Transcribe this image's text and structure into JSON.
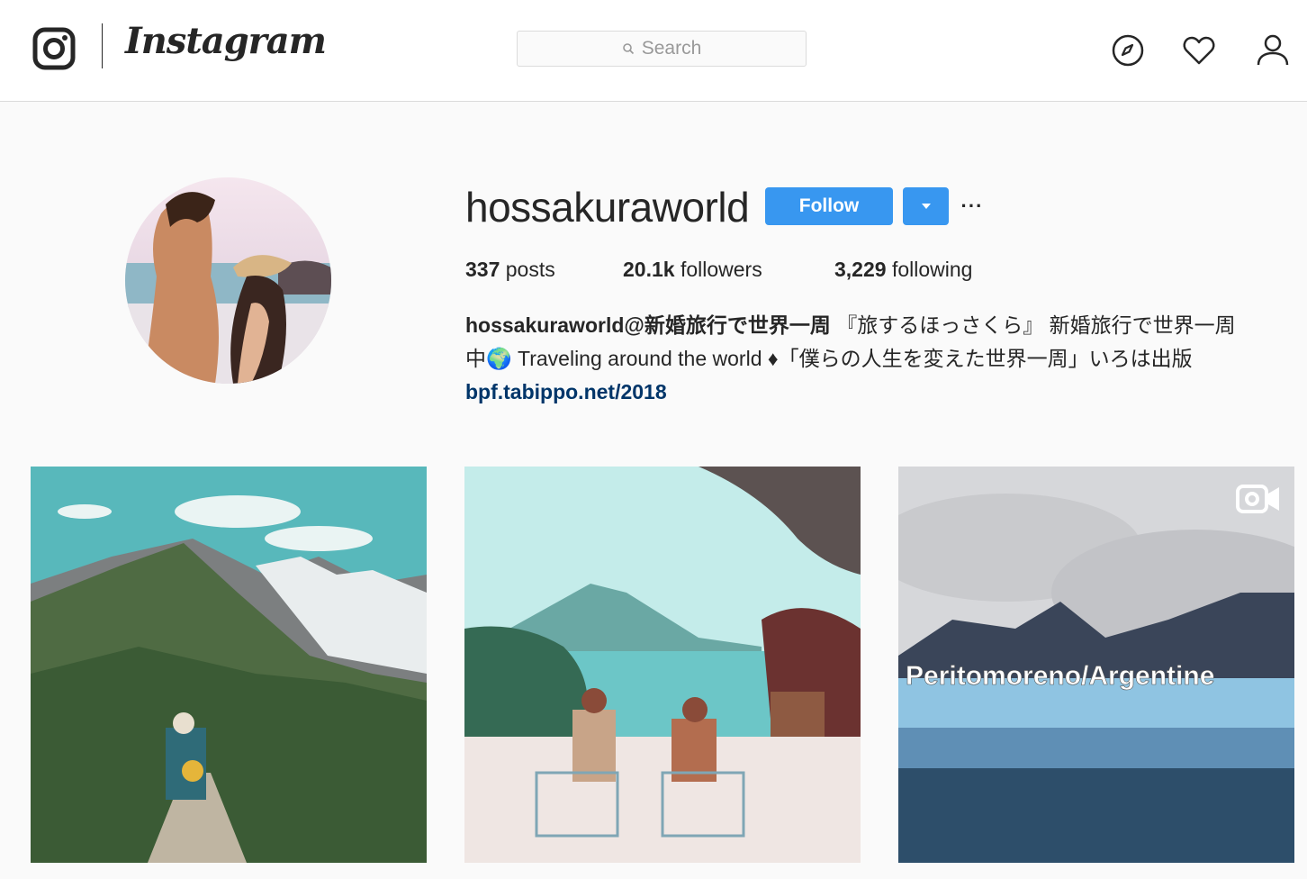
{
  "header": {
    "brand": "Instagram",
    "search_placeholder": "Search"
  },
  "profile": {
    "username": "hossakuraworld",
    "follow_label": "Follow",
    "more_label": "···",
    "stats": {
      "posts_count": "337",
      "posts_label": "posts",
      "followers_count": "20.1k",
      "followers_label": "followers",
      "following_count": "3,229",
      "following_label": "following"
    },
    "bio": {
      "name": "hossakuraworld@新婚旅行で世界一周",
      "line1_rest": " 『旅するほっさくら』 新婚旅行で世界一周",
      "line2": "中🌍 Traveling around the world ♦「僕らの人生を変えた世界一周」いろは出版",
      "link": "bpf.tabippo.net/2018"
    }
  },
  "posts": [
    {
      "caption": "",
      "is_video": false
    },
    {
      "caption": "",
      "is_video": false
    },
    {
      "caption": "Peritomoreno/Argentine",
      "is_video": true
    }
  ],
  "colors": {
    "accent": "#3897f0",
    "link": "#003569",
    "text": "#262626",
    "background": "#fafafa"
  },
  "icons": [
    "instagram-camera-icon",
    "search-icon",
    "explore-compass-icon",
    "heart-icon",
    "profile-person-icon",
    "caret-down-icon",
    "video-camera-icon"
  ]
}
